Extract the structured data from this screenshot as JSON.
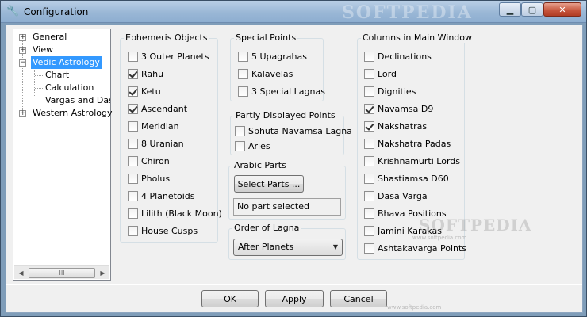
{
  "window": {
    "title": "Configuration",
    "watermark": "SOFTPEDIA"
  },
  "tree": {
    "items": [
      {
        "label": "General",
        "expander": "+"
      },
      {
        "label": "View",
        "expander": "+"
      },
      {
        "label": "Vedic Astrology",
        "expander": "−",
        "selected": true
      },
      {
        "label": "Chart"
      },
      {
        "label": "Calculation"
      },
      {
        "label": "Vargas and Dasa"
      },
      {
        "label": "Western Astrology",
        "expander": "+"
      }
    ],
    "scroll_thumb_glyph": "III"
  },
  "ephemeris": {
    "title": "Ephemeris Objects",
    "items": [
      {
        "label": "3 Outer Planets",
        "checked": false
      },
      {
        "label": "Rahu",
        "checked": true
      },
      {
        "label": "Ketu",
        "checked": true
      },
      {
        "label": "Ascendant",
        "checked": true
      },
      {
        "label": "Meridian",
        "checked": false
      },
      {
        "label": "8 Uranian",
        "checked": false
      },
      {
        "label": "Chiron",
        "checked": false
      },
      {
        "label": "Pholus",
        "checked": false
      },
      {
        "label": "4 Planetoids",
        "checked": false
      },
      {
        "label": "Lilith (Black Moon)",
        "checked": false
      },
      {
        "label": "House Cusps",
        "checked": false
      }
    ]
  },
  "special_points": {
    "title": "Special Points",
    "items": [
      {
        "label": "5 Upagrahas",
        "checked": false
      },
      {
        "label": "Kalavelas",
        "checked": false
      },
      {
        "label": "3 Special Lagnas",
        "checked": false
      }
    ]
  },
  "partly": {
    "title": "Partly Displayed Points",
    "items": [
      {
        "label": "Sphuta Navamsa Lagna",
        "checked": false
      },
      {
        "label": "Aries",
        "checked": false
      }
    ]
  },
  "arabic": {
    "title": "Arabic Parts",
    "button": "Select Parts ...",
    "status": "No part selected"
  },
  "lagna": {
    "title": "Order of Lagna",
    "selected": "After Planets"
  },
  "columns": {
    "title": "Columns in Main Window",
    "items": [
      {
        "label": "Declinations",
        "checked": false
      },
      {
        "label": "Lord",
        "checked": false
      },
      {
        "label": "Dignities",
        "checked": false
      },
      {
        "label": "Navamsa D9",
        "checked": true
      },
      {
        "label": "Nakshatras",
        "checked": true
      },
      {
        "label": "Nakshatra Padas",
        "checked": false
      },
      {
        "label": "Krishnamurti Lords",
        "checked": false
      },
      {
        "label": "Shastiamsa D60",
        "checked": false
      },
      {
        "label": "Dasa Varga",
        "checked": false
      },
      {
        "label": "Bhava Positions",
        "checked": false
      },
      {
        "label": "Jamini Karakas",
        "checked": false
      },
      {
        "label": "Ashtakavarga Points",
        "checked": false
      }
    ]
  },
  "footer": {
    "ok": "OK",
    "apply": "Apply",
    "cancel": "Cancel"
  },
  "watermark_small": "www.softpedia.com",
  "colors": {
    "selection": "#3399ff",
    "close_button": "#c5533a"
  }
}
